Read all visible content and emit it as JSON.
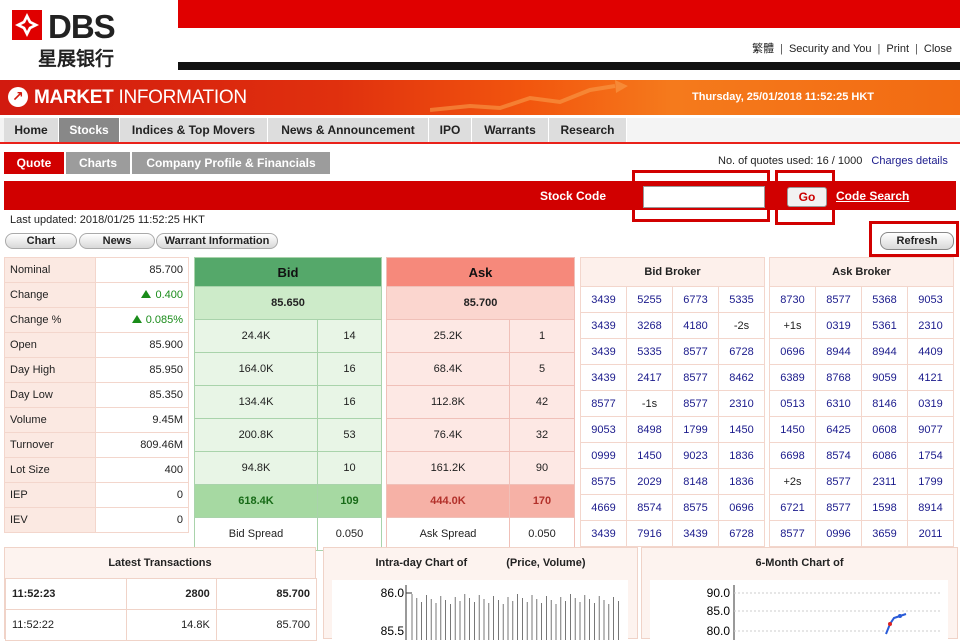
{
  "header": {
    "brand": "DBS",
    "brand_chinese": "星展银行",
    "links": [
      "繁體",
      "Security and You",
      "Print",
      "Close"
    ]
  },
  "banner": {
    "title_bold": "MARKET",
    "title_rest": " INFORMATION",
    "datetime": "Thursday, 25/01/2018 11:52:25 HKT"
  },
  "main_tabs": [
    "Home",
    "Stocks",
    "Indices & Top Movers",
    "News & Announcement",
    "IPO",
    "Warrants",
    "Research"
  ],
  "active_main_tab": "Stocks",
  "sub_tabs": [
    "Quote",
    "Charts",
    "Company Profile & Financials"
  ],
  "quotes_used": {
    "text": "No. of quotes used: 16  /  1000",
    "link": "Charges details"
  },
  "search": {
    "label": "Stock Code",
    "value": "",
    "go_label": "Go",
    "code_search_label": "Code Search"
  },
  "last_updated": "Last updated: 2018/01/25 11:52:25 HKT",
  "buttons": {
    "chart": "Chart",
    "news": "News",
    "warrant": "Warrant Information",
    "refresh": "Refresh"
  },
  "quote": {
    "nominal": {
      "label": "Nominal",
      "value": "85.700"
    },
    "change": {
      "label": "Change",
      "value": "0.400"
    },
    "change_pct": {
      "label": "Change %",
      "value": "0.085%"
    },
    "open": {
      "label": "Open",
      "value": "85.900"
    },
    "day_high": {
      "label": "Day High",
      "value": "85.950"
    },
    "day_low": {
      "label": "Day Low",
      "value": "85.350"
    },
    "volume": {
      "label": "Volume",
      "value": "9.45M"
    },
    "turnover": {
      "label": "Turnover",
      "value": "809.46M"
    },
    "lot_size": {
      "label": "Lot Size",
      "value": "400"
    },
    "iep": {
      "label": "IEP",
      "value": "0"
    },
    "iev": {
      "label": "IEV",
      "value": "0"
    }
  },
  "bid": {
    "title": "Bid",
    "price": "85.650",
    "rows": [
      [
        "24.4K",
        "14"
      ],
      [
        "164.0K",
        "16"
      ],
      [
        "134.4K",
        "16"
      ],
      [
        "200.8K",
        "53"
      ],
      [
        "94.8K",
        "10"
      ]
    ],
    "total": [
      "618.4K",
      "109"
    ],
    "spread_label": "Bid Spread",
    "spread": "0.050"
  },
  "ask": {
    "title": "Ask",
    "price": "85.700",
    "rows": [
      [
        "25.2K",
        "1"
      ],
      [
        "68.4K",
        "5"
      ],
      [
        "112.8K",
        "42"
      ],
      [
        "76.4K",
        "32"
      ],
      [
        "161.2K",
        "90"
      ]
    ],
    "total": [
      "444.0K",
      "170"
    ],
    "spread_label": "Ask Spread",
    "spread": "0.050"
  },
  "bid_broker": {
    "title": "Bid Broker",
    "rows": [
      [
        "3439",
        "5255",
        "6773",
        "5335"
      ],
      [
        "3439",
        "3268",
        "4180",
        "-2s"
      ],
      [
        "3439",
        "5335",
        "8577",
        "6728"
      ],
      [
        "3439",
        "2417",
        "8577",
        "8462"
      ],
      [
        "8577",
        "-1s",
        "8577",
        "2310"
      ],
      [
        "9053",
        "8498",
        "1799",
        "1450"
      ],
      [
        "0999",
        "1450",
        "9023",
        "1836"
      ],
      [
        "8575",
        "2029",
        "8148",
        "1836"
      ],
      [
        "4669",
        "8574",
        "8575",
        "0696"
      ],
      [
        "3439",
        "7916",
        "3439",
        "6728"
      ]
    ]
  },
  "ask_broker": {
    "title": "Ask Broker",
    "rows": [
      [
        "8730",
        "8577",
        "5368",
        "9053"
      ],
      [
        "+1s",
        "0319",
        "5361",
        "2310"
      ],
      [
        "0696",
        "8944",
        "8944",
        "4409"
      ],
      [
        "6389",
        "8768",
        "9059",
        "4121"
      ],
      [
        "0513",
        "6310",
        "8146",
        "0319"
      ],
      [
        "1450",
        "6425",
        "0608",
        "9077"
      ],
      [
        "6698",
        "8574",
        "6086",
        "1754"
      ],
      [
        "+2s",
        "8577",
        "2311",
        "1799"
      ],
      [
        "6721",
        "8577",
        "1598",
        "8914"
      ],
      [
        "8577",
        "0996",
        "3659",
        "2011"
      ]
    ]
  },
  "latest_transactions": {
    "title": "Latest Transactions",
    "rows": [
      [
        "11:52:23",
        "2800",
        "85.700"
      ],
      [
        "11:52:22",
        "14.8K",
        "85.700"
      ]
    ]
  },
  "intraday_chart": {
    "title": "Intra-day Chart of",
    "subtitle": "(Price, Volume)",
    "y_ticks": [
      "86.0",
      "85.5"
    ]
  },
  "six_month_chart": {
    "title": "6-Month Chart of",
    "y_ticks": [
      "90.0",
      "85.0",
      "80.0"
    ]
  },
  "colors": {
    "brand_red": "#e00000",
    "bid_green": "#55a86a",
    "ask_red": "#f6897b"
  }
}
